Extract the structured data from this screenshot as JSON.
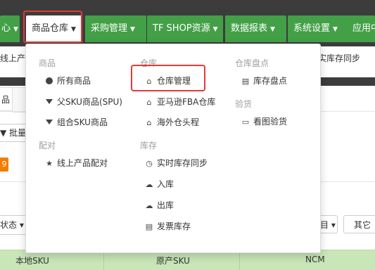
{
  "nav": {
    "items": [
      {
        "label": "心",
        "caret": "▼"
      },
      {
        "label": "商品仓库",
        "caret": "▼"
      },
      {
        "label": "采购管理",
        "caret": "▼"
      },
      {
        "label": "TF SHOP资源",
        "caret": "▼"
      },
      {
        "label": "数据报表",
        "caret": "▼"
      },
      {
        "label": "系统设置",
        "caret": "▼"
      },
      {
        "label": "应用中",
        "caret": ""
      }
    ],
    "active_color": "#ffffff",
    "item_color": "#43a047"
  },
  "background": {
    "sub_left": "线上产品",
    "sub_right": "实库存同步",
    "tab_fragment": "品",
    "batch_label": "▼ 批量",
    "badge": "9",
    "status_label": "状态 ▾",
    "right_btn1": "目 ▾",
    "right_btn2": "其它",
    "table_headers": [
      "本地SKU",
      "原产SKU",
      "NCM"
    ]
  },
  "menu": {
    "col1": {
      "group1": "商品",
      "items1": [
        {
          "label": "所有商品",
          "icon": "circle-icon"
        },
        {
          "label": "父SKU商品(SPU)",
          "icon": "filter-icon"
        },
        {
          "label": "组合SKU商品",
          "icon": "filter-icon"
        }
      ],
      "group2": "配对",
      "items2": [
        {
          "label": "线上产品配对",
          "icon": "star-icon"
        }
      ]
    },
    "col2": {
      "group1": "仓库",
      "items1": [
        {
          "label": "仓库管理",
          "icon": "home-icon"
        },
        {
          "label": "亚马逊FBA仓库",
          "icon": "home-icon"
        },
        {
          "label": "海外仓头程",
          "icon": "home-icon"
        }
      ],
      "group2": "库存",
      "items2": [
        {
          "label": "实时库存同步",
          "icon": "clock-icon"
        },
        {
          "label": "入库",
          "icon": "cloud-upload-icon"
        },
        {
          "label": "出库",
          "icon": "cloud-download-icon"
        },
        {
          "label": "发票库存",
          "icon": "list-icon"
        }
      ]
    },
    "col3": {
      "group1": "仓库盘点",
      "items1": [
        {
          "label": "库存盘点",
          "icon": "list-icon"
        }
      ],
      "group2": "验货",
      "items2": [
        {
          "label": "看图验货",
          "icon": "monitor-icon"
        }
      ]
    }
  },
  "highlight_color": "#e53935"
}
